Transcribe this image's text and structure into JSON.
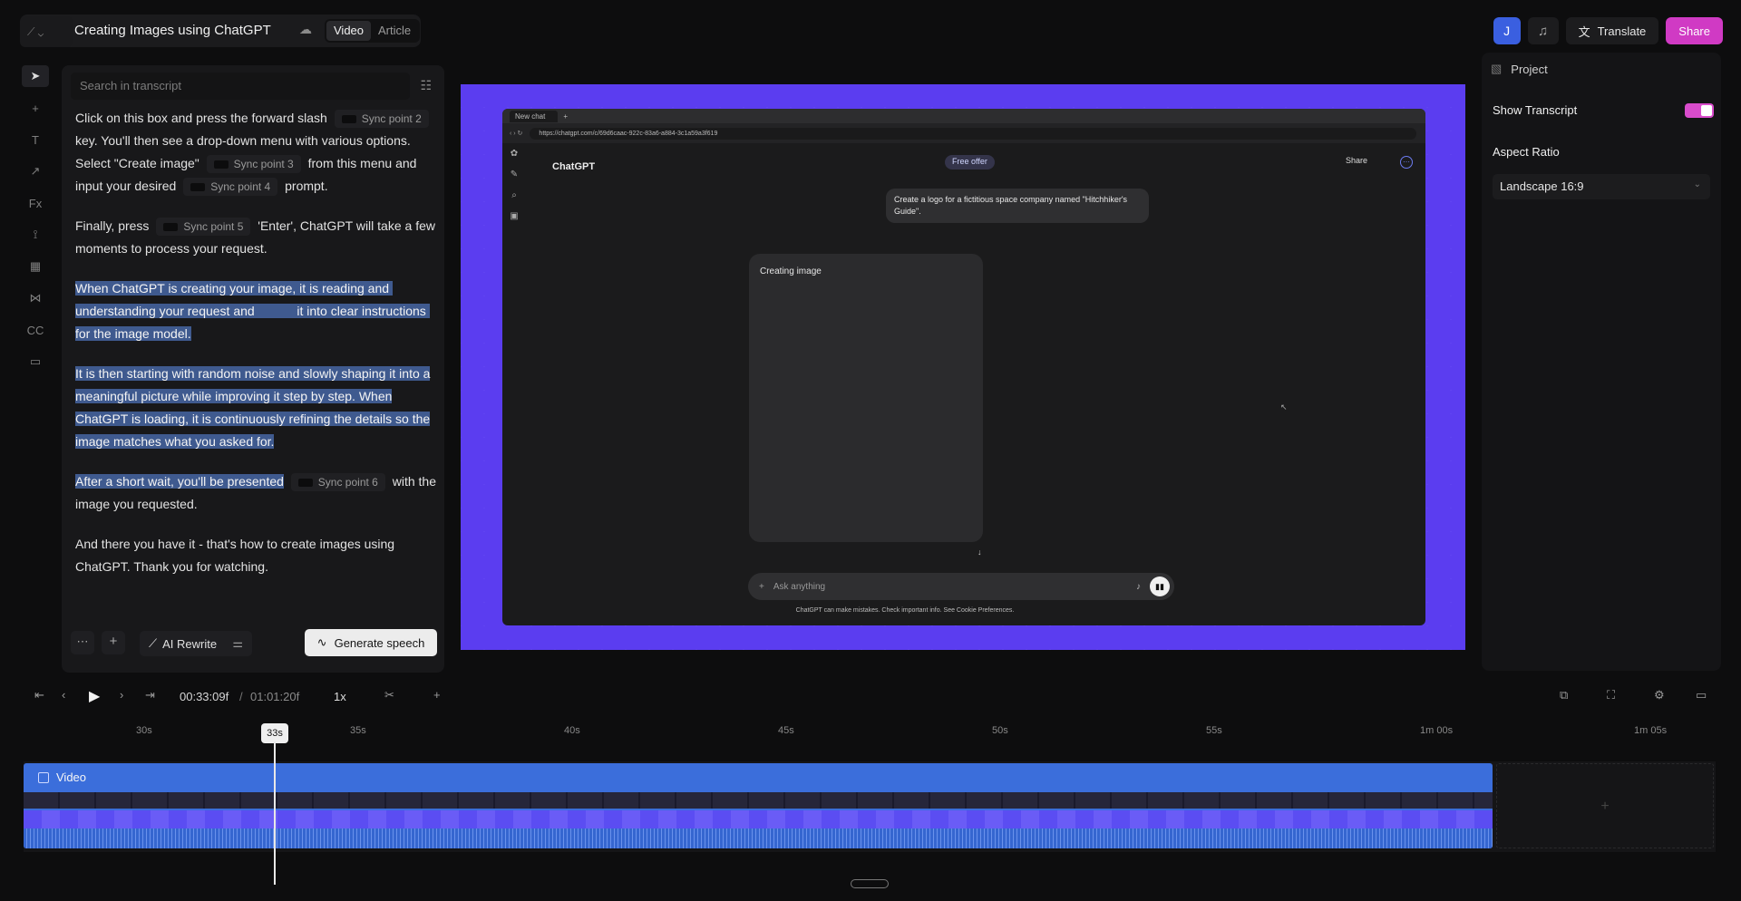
{
  "header": {
    "doc_title": "Creating Images using ChatGPT",
    "mode_tabs": [
      "Video",
      "Article"
    ],
    "active_mode": "Video",
    "user_initial": "J",
    "translate_label": "Translate",
    "share_label": "Share"
  },
  "transcript": {
    "search_placeholder": "Search in transcript",
    "p1_a": "Click on this box and press the forward slash",
    "p1_sync2": "Sync point 2",
    "p1_b": "key. You'll then see a drop-down menu with various options. Select \"Create image\"",
    "p1_sync3": "Sync point 3",
    "p1_c": "from this menu and input your desired",
    "p1_sync4": "Sync point 4",
    "p1_d": "prompt.",
    "p2_a": "Finally, press",
    "p2_sync5": "Sync point 5",
    "p2_b": "'Enter', ChatGPT will take a few moments to process your request.",
    "p3": "When ChatGPT is creating your image, it is reading and understanding your request and            it into clear instructions for the image model.",
    "p4": "It is then starting with random noise and slowly shaping it into a meaningful picture while improving it step by step. When ChatGPT is loading, it is continuously refining the details so the image matches what you asked for.",
    "p5_a": "After a short wait, you'll be presented",
    "p5_sync6": "Sync point 6",
    "p5_b": "with the image you requested.",
    "p6": "And there you have it - that's how to create images using ChatGPT. Thank you for watching.",
    "ai_rewrite_label": "AI Rewrite",
    "generate_speech_label": "Generate speech"
  },
  "preview": {
    "tab_label": "New chat",
    "url": "https://chatgpt.com/c/69d6caac-922c-83a6-a884-3c1a59a3f619",
    "brand": "ChatGPT",
    "free_offer": "Free offer",
    "share": "Share",
    "user_message": "Create a logo for a fictitious space company named \"Hitchhiker's Guide\".",
    "creating_label": "Creating image",
    "ask_placeholder": "Ask anything",
    "disclaimer": "ChatGPT can make mistakes. Check important info. See Cookie Preferences."
  },
  "right_panel": {
    "tab": "Project",
    "show_transcript_label": "Show Transcript",
    "show_transcript": true,
    "aspect_ratio_label": "Aspect Ratio",
    "aspect_ratio_value": "Landscape 16:9"
  },
  "playback": {
    "current_time": "00:33:09f",
    "separator": "/",
    "total_time": "01:01:20f",
    "speed": "1x"
  },
  "timeline": {
    "ticks": [
      "30s",
      "35s",
      "40s",
      "45s",
      "50s",
      "55s",
      "1m 00s",
      "1m 05s"
    ],
    "playhead": "33s",
    "track_label": "Video"
  },
  "colors": {
    "accent_pink": "#d03ac4",
    "accent_blue": "#3a5fe0",
    "canvas_purple": "#5b3df0",
    "track_blue": "#3b6edb"
  }
}
